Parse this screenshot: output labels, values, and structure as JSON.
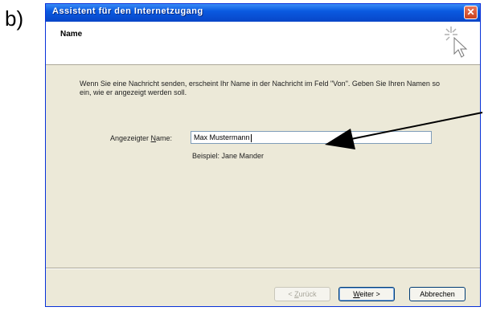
{
  "figure_label": "b)",
  "window": {
    "title": "Assistent für den Internetzugang",
    "close_glyph": "✕"
  },
  "header": {
    "title": "Name"
  },
  "body": {
    "description": "Wenn Sie eine Nachricht senden, erscheint Ihr Name in der Nachricht im Feld \"Von\". Geben Sie Ihren Namen so ein, wie er angezeigt werden soll.",
    "name_label_prefix": "Angezeigter ",
    "name_label_accel": "N",
    "name_label_suffix": "ame:",
    "name_value": "Max Mustermann",
    "example": "Beispiel: Jane Mander"
  },
  "buttons": {
    "back_accel": "Z",
    "back_rest": "urück",
    "back_prefix": "< ",
    "next_accel": "W",
    "next_rest": "eiter >",
    "cancel": "Abbrechen"
  },
  "colors": {
    "titlebar": "#0a5ae0",
    "dialog_bg": "#ece9d8"
  }
}
